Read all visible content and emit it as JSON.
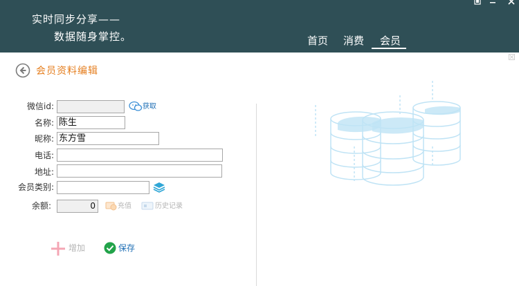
{
  "header": {
    "slogan_line1": "实时同步分享——",
    "slogan_line2": "数据随身掌控。",
    "nav": [
      {
        "label": "首页",
        "active": false
      },
      {
        "label": "消费",
        "active": false
      },
      {
        "label": "会员",
        "active": true
      }
    ],
    "window_controls": [
      "restore",
      "minimize",
      "close"
    ]
  },
  "page": {
    "title": "会员资料编辑",
    "back_icon": "back-arrow-circle-icon"
  },
  "form": {
    "wechat_label": "微信id:",
    "wechat_value": "",
    "fetch_label": "获取",
    "name_label": "名称:",
    "name_value": "陈生",
    "nickname_label": "昵称:",
    "nickname_value": "东方雪",
    "phone_label": "电话:",
    "phone_value": "",
    "address_label": "地址:",
    "address_value": "",
    "category_label": "会员类别:",
    "category_value": "",
    "balance_label": "余额:",
    "balance_value": "0",
    "recharge_label": "充值",
    "history_label": "历史记录"
  },
  "actions": {
    "add_label": "增加",
    "save_label": "保存"
  },
  "colors": {
    "header_bg": "#2f4f56",
    "title_orange": "#e57e1e",
    "link_blue": "#1f6fb5",
    "disabled_gray": "#b5b5b5",
    "save_green": "#22a34a",
    "add_pink": "#f4a6b4",
    "illustration_blue": "#bfe3f5"
  }
}
